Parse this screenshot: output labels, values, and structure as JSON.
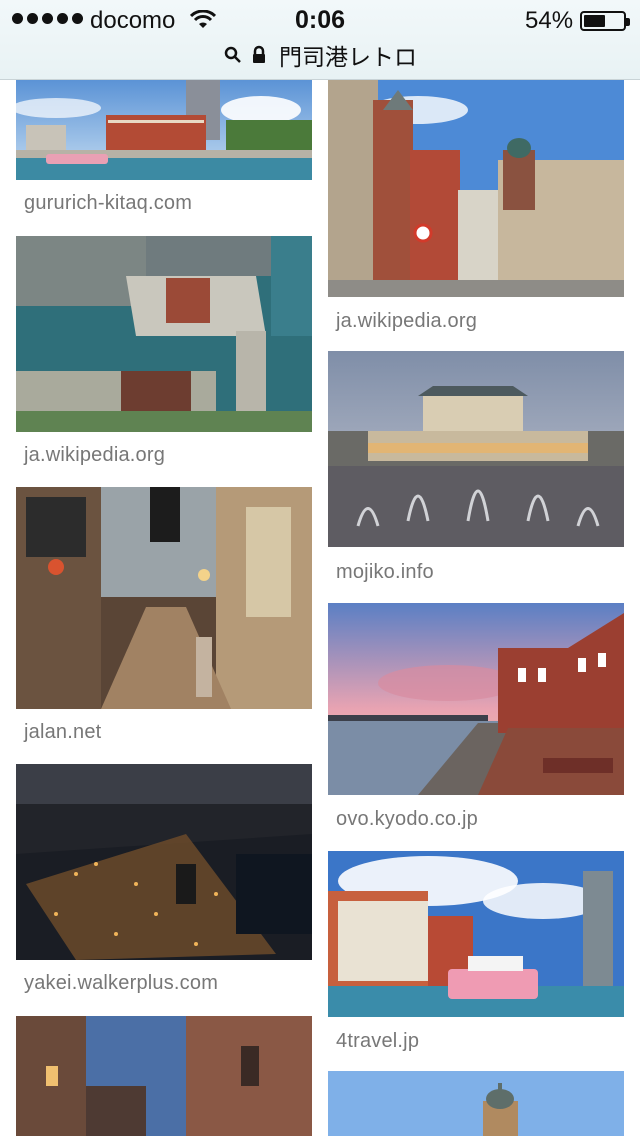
{
  "status_bar": {
    "carrier": "docomo",
    "time": "0:06",
    "battery_percent": "54%",
    "battery_level": 0.54
  },
  "address_bar": {
    "url": "門司港レトロ"
  },
  "results": {
    "left": [
      {
        "source": "gururich-kitaq.com",
        "icon": "harbor-photo"
      },
      {
        "source": "ja.wikipedia.org",
        "icon": "aerial-harbor-photo"
      },
      {
        "source": "jalan.net",
        "icon": "retro-street-photo"
      },
      {
        "source": "yakei.walkerplus.com",
        "icon": "night-view-photo"
      },
      {
        "source": "",
        "icon": "building-dusk-photo"
      }
    ],
    "right": [
      {
        "source": "ja.wikipedia.org",
        "icon": "brick-street-photo"
      },
      {
        "source": "mojiko.info",
        "icon": "station-fountain-photo"
      },
      {
        "source": "ovo.kyodo.co.jp",
        "icon": "sunset-promenade-photo"
      },
      {
        "source": "4travel.jp",
        "icon": "pier-boat-photo"
      },
      {
        "source": "",
        "icon": "tower-photo"
      }
    ]
  }
}
